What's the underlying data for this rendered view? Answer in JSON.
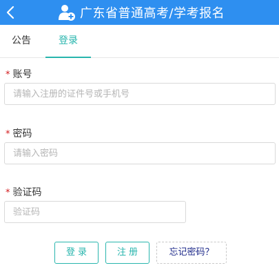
{
  "header": {
    "title": "广东省普通高考/学考报名",
    "back_icon": "chevron-left-icon",
    "user_icon": "user-add-icon",
    "background_color": "#2e8ff0"
  },
  "tabs": [
    {
      "label": "公告",
      "active": false
    },
    {
      "label": "登录",
      "active": true
    }
  ],
  "form": {
    "account": {
      "label": "账号",
      "required_mark": "*",
      "placeholder": "请输入注册的证件号或手机号",
      "value": ""
    },
    "password": {
      "label": "密码",
      "required_mark": "*",
      "placeholder": "请输入密码",
      "value": ""
    },
    "captcha": {
      "label": "验证码",
      "required_mark": "*",
      "placeholder": "验证码",
      "value": ""
    }
  },
  "buttons": {
    "login": "登录",
    "register": "注册",
    "forgot": "忘记密码？"
  },
  "colors": {
    "accent": "#27b5ad",
    "required": "#d2191c",
    "forgot_text": "#1e2a8a"
  }
}
